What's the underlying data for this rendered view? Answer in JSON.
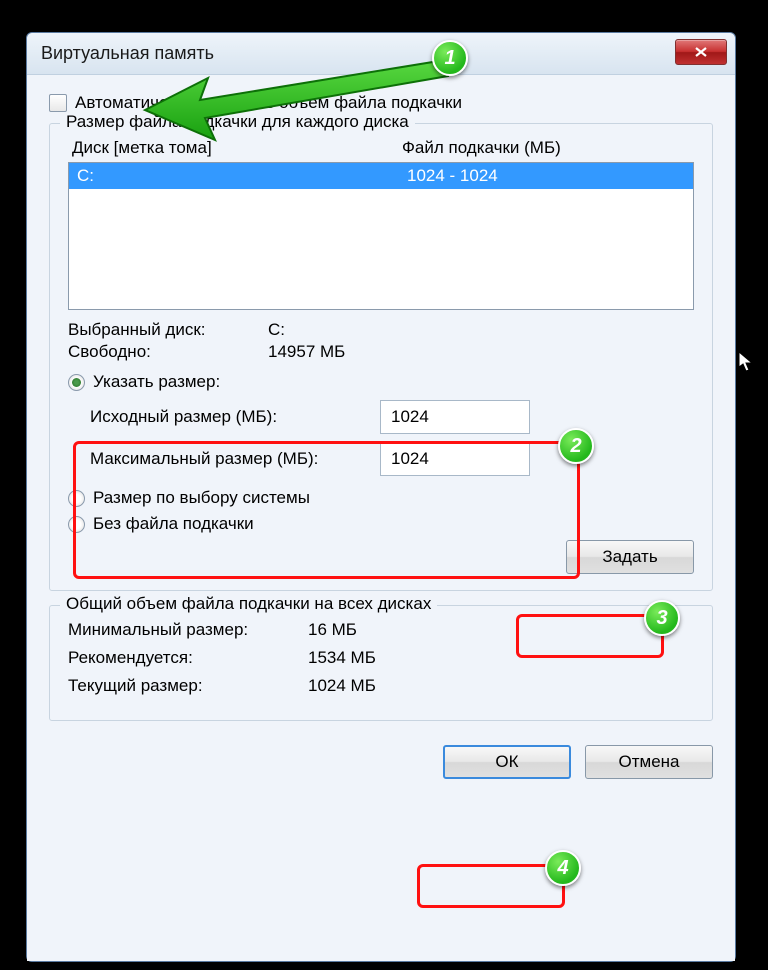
{
  "title": "Виртуальная память",
  "checkbox_label": "Автоматически выбирать объем файла подкачки",
  "group1": {
    "legend": "Размер файла подкачки для каждого диска",
    "col_disk": "Диск [метка тома]",
    "col_file": "Файл подкачки (МБ)",
    "rows": [
      {
        "disk": "C:",
        "file": "1024 - 1024"
      }
    ],
    "selected_disk_label": "Выбранный диск:",
    "selected_disk_value": "C:",
    "free_label": "Свободно:",
    "free_value": "14957 МБ",
    "radio_custom": "Указать размер:",
    "initial_label": "Исходный размер (МБ):",
    "initial_value": "1024",
    "max_label": "Максимальный размер (МБ):",
    "max_value": "1024",
    "radio_system": "Размер по выбору системы",
    "radio_none": "Без файла подкачки",
    "set_btn": "Задать"
  },
  "group2": {
    "legend": "Общий объем файла подкачки на всех дисках",
    "min_label": "Минимальный размер:",
    "min_value": "16 МБ",
    "rec_label": "Рекомендуется:",
    "rec_value": "1534 МБ",
    "cur_label": "Текущий размер:",
    "cur_value": "1024 МБ"
  },
  "ok_btn": "ОК",
  "cancel_btn": "Отмена",
  "annotations": {
    "b1": "1",
    "b2": "2",
    "b3": "3",
    "b4": "4"
  }
}
